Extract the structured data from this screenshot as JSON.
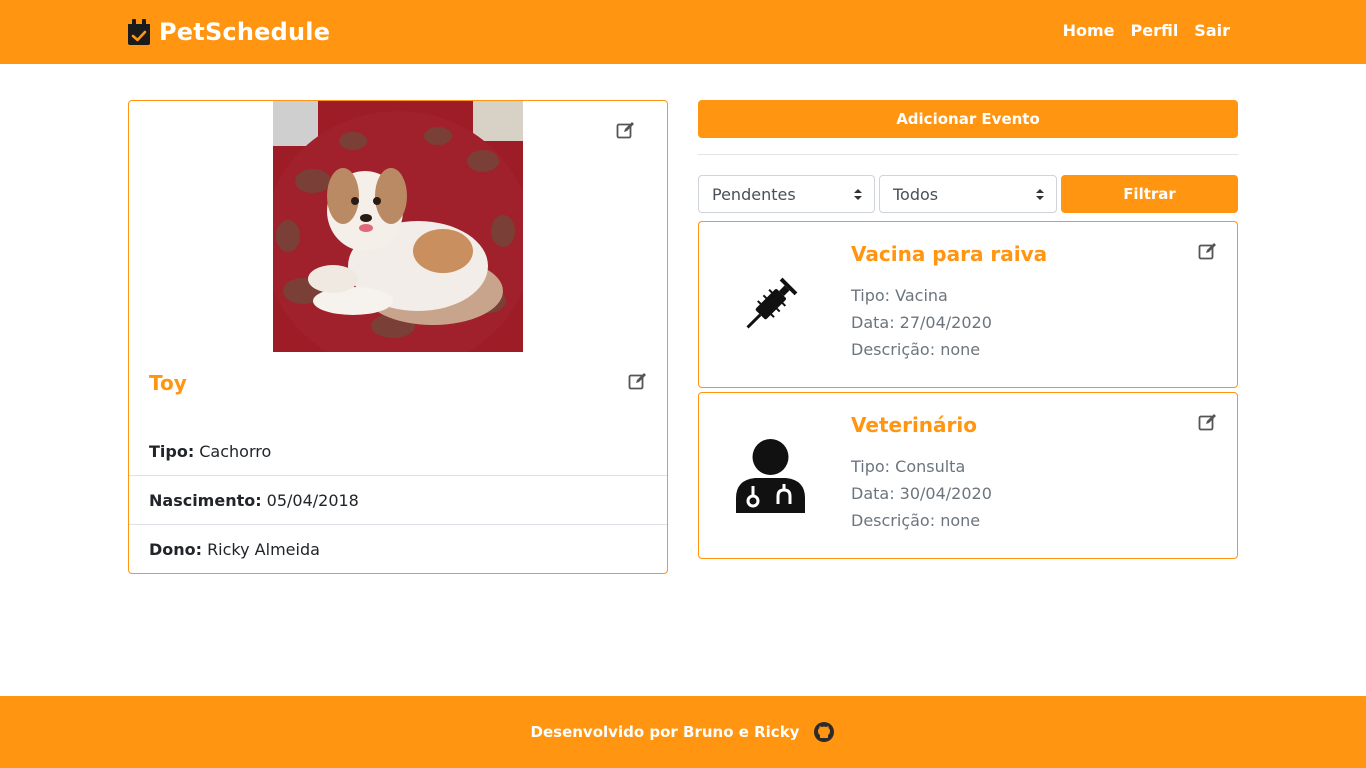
{
  "app": {
    "brand": "PetSchedule",
    "nav": {
      "home": "Home",
      "profile": "Perfil",
      "logout": "Sair"
    }
  },
  "colors": {
    "accent": "#ff9511",
    "muted": "#6c757d",
    "border": "#dee2e6"
  },
  "pet": {
    "name": "Toy",
    "info": [
      {
        "label": "Tipo:",
        "value": "Cachorro"
      },
      {
        "label": "Nascimento:",
        "value": "05/04/2018"
      },
      {
        "label": "Dono:",
        "value": "Ricky Almeida"
      }
    ]
  },
  "events_panel": {
    "add_button": "Adicionar Evento",
    "status_select": "Pendentes",
    "type_select": "Todos",
    "filter_button": "Filtrar"
  },
  "events": [
    {
      "icon": "syringe-icon",
      "title": "Vacina para raiva",
      "type": "Tipo: Vacina",
      "date": "Data: 27/04/2020",
      "description": "Descrição: none"
    },
    {
      "icon": "doctor-icon",
      "title": "Veterinário",
      "type": "Tipo: Consulta",
      "date": "Data: 30/04/2020",
      "description": "Descrição: none"
    }
  ],
  "footer": {
    "text": "Desenvolvido por Bruno e Ricky",
    "icon": "github-icon"
  }
}
